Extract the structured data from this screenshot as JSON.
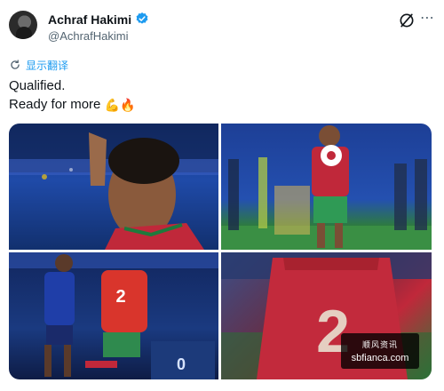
{
  "post": {
    "author_name": "Achraf Hakimi",
    "author_handle": "@AchrafHakimi",
    "translate_label": "显示翻译",
    "text_line1": "Qualified.",
    "text_line2": "Ready for more",
    "emoji": [
      "flexed-biceps",
      "fire"
    ],
    "verified_color": "#1d9bf0",
    "link_color": "#1d9bf0"
  },
  "media": {
    "photos": [
      {
        "alt_name": "hakimi-closeup-photo",
        "jersey_number": ""
      },
      {
        "alt_name": "player-holding-ball-photo",
        "jersey_number": ""
      },
      {
        "alt_name": "player-number-2-photo",
        "jersey_number": "2"
      },
      {
        "alt_name": "jersey-back-number-2-photo",
        "jersey_number": "2"
      }
    ]
  },
  "watermark": {
    "top": "顺风资讯",
    "url": "sbfianca.com"
  }
}
